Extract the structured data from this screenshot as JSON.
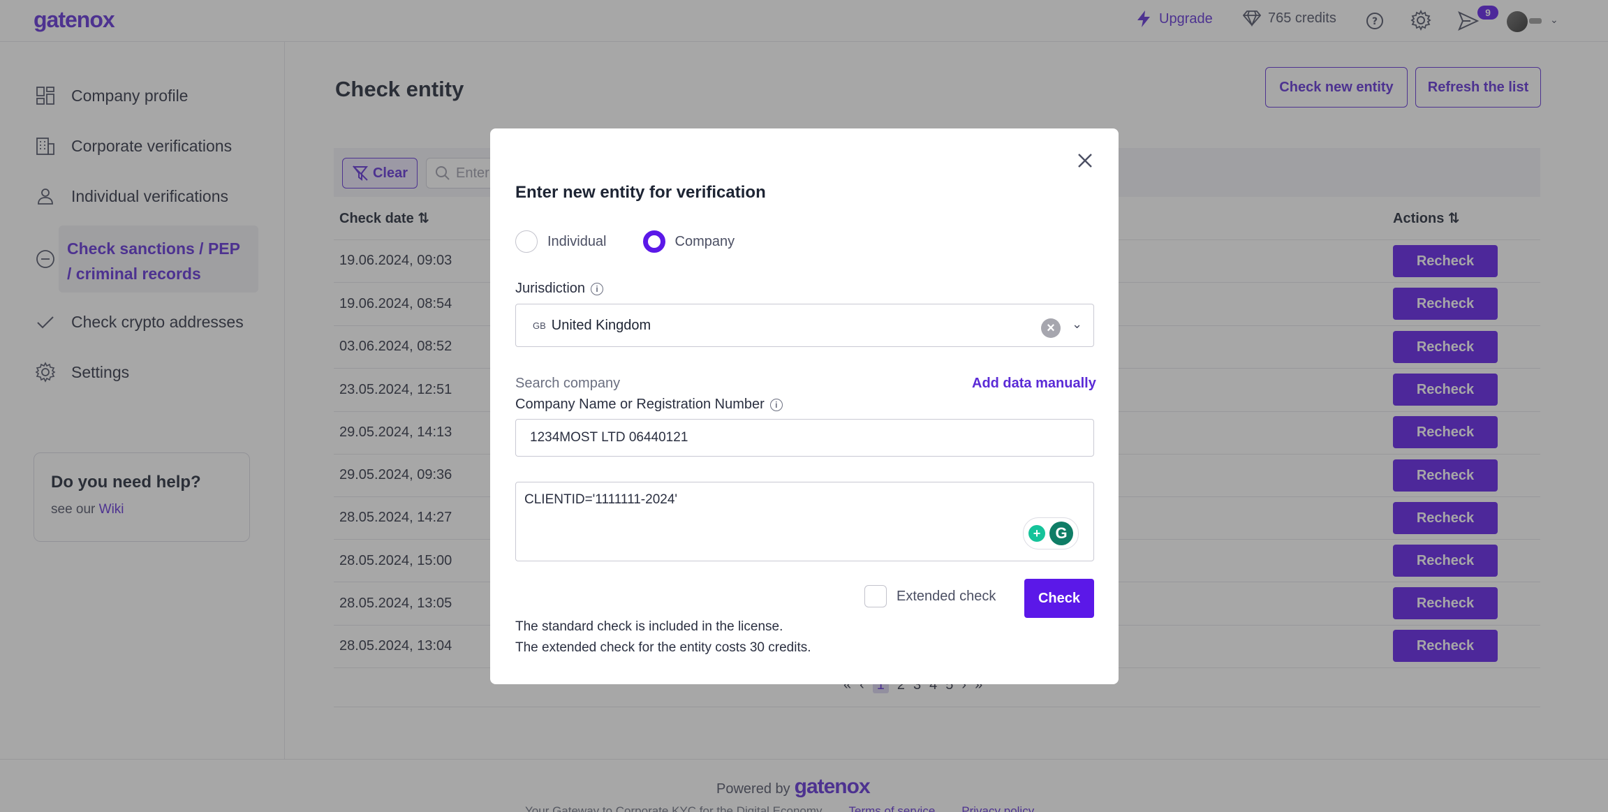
{
  "header": {
    "logo": "gatenox",
    "upgrade_label": "Upgrade",
    "credits_label": "765 credits",
    "notifications_count": "9"
  },
  "sidebar": {
    "items": [
      {
        "label": "Company profile",
        "icon": "dashboard-icon"
      },
      {
        "label": "Corporate verifications",
        "icon": "building-icon"
      },
      {
        "label": "Individual verifications",
        "icon": "person-icon"
      },
      {
        "label": "Check sanctions / PEP / criminal records",
        "icon": "minus-circle-icon",
        "active": true
      },
      {
        "label": "Check crypto addresses",
        "icon": "checkmark-icon"
      },
      {
        "label": "Settings",
        "icon": "gear-icon"
      }
    ],
    "help": {
      "title": "Do you need help?",
      "prefix": "see our",
      "link": "Wiki"
    }
  },
  "main": {
    "title": "Check entity",
    "check_new_label": "Check new entity",
    "refresh_label": "Refresh the list",
    "clear_label": "Clear",
    "filter_placeholder": "Enter",
    "columns": {
      "date": "Check date ⇅",
      "actions": "Actions ⇅"
    },
    "rows": [
      "19.06.2024, 09:03",
      "19.06.2024, 08:54",
      "03.06.2024, 08:52",
      "23.05.2024, 12:51",
      "29.05.2024, 14:13",
      "29.05.2024, 09:36",
      "28.05.2024, 14:27",
      "28.05.2024, 15:00",
      "28.05.2024, 13:05",
      "28.05.2024, 13:04"
    ],
    "recheck_label": "Recheck",
    "pagination": {
      "pages": [
        "1",
        "2",
        "3",
        "4",
        "5"
      ],
      "current": "1"
    }
  },
  "footer": {
    "powered_by": "Powered by",
    "brand": "gatenox",
    "tagline": "Your Gateway to Corporate KYC for the Digital Economy",
    "terms": "Terms of service",
    "privacy": "Privacy policy"
  },
  "modal": {
    "title": "Enter new entity for verification",
    "radio_individual": "Individual",
    "radio_company": "Company",
    "selected_type": "Company",
    "jurisdiction_label": "Jurisdiction",
    "jurisdiction_code": "GB",
    "jurisdiction_value": "United Kingdom",
    "search_company_label": "Search company",
    "add_manual_label": "Add data manually",
    "company_field_label": "Company Name or Registration Number",
    "company_field_value": "1234MOST LTD 06440121",
    "notes_value": "CLIENTID='1111111-2024'",
    "extended_check_label": "Extended check",
    "check_button": "Check",
    "note_standard": "The standard check is included in the license.",
    "note_extended": "The extended check for the entity costs 30 credits."
  },
  "colors": {
    "accent": "#5b18e8",
    "brand": "#5b2bd6"
  }
}
